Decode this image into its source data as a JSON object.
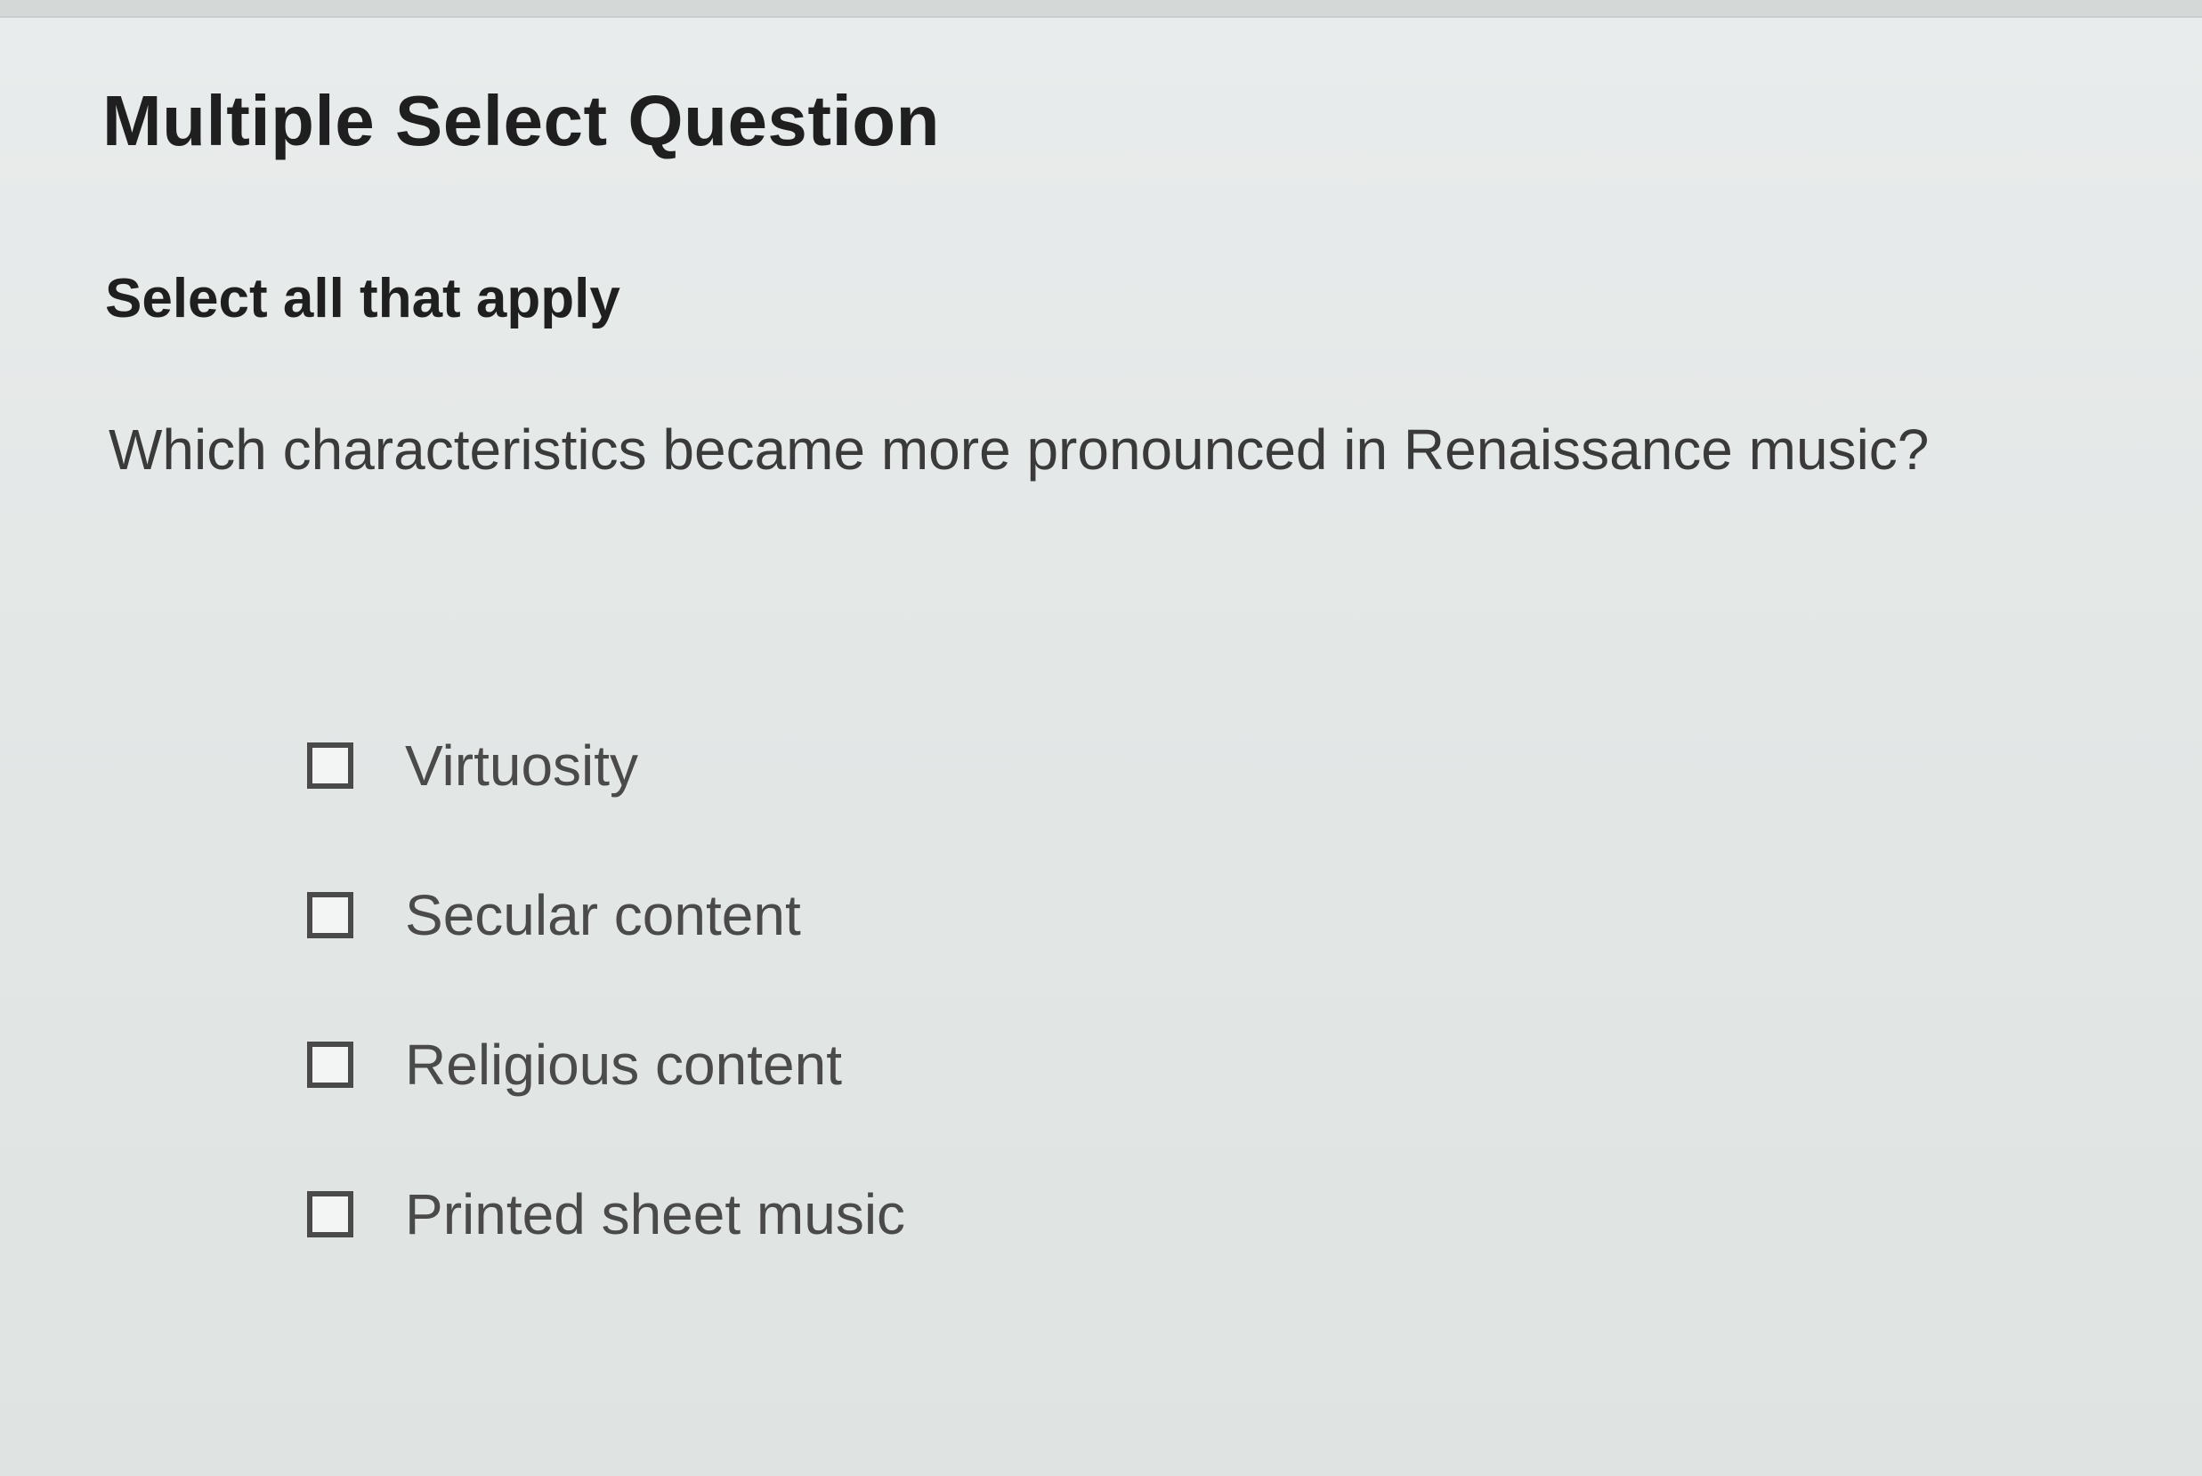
{
  "question": {
    "type_label": "Multiple Select Question",
    "instruction": "Select all that apply",
    "prompt": "Which characteristics became more pronounced in Renaissance music?"
  },
  "options": [
    {
      "label": "Virtuosity",
      "checked": false
    },
    {
      "label": "Secular content",
      "checked": false
    },
    {
      "label": "Religious content",
      "checked": false
    },
    {
      "label": "Printed sheet music",
      "checked": false
    }
  ],
  "colors": {
    "background": "#e6eaea",
    "text_dark": "#1f1f1f",
    "text_option": "#4a4a4a",
    "checkbox_border": "#4a4a4a"
  }
}
